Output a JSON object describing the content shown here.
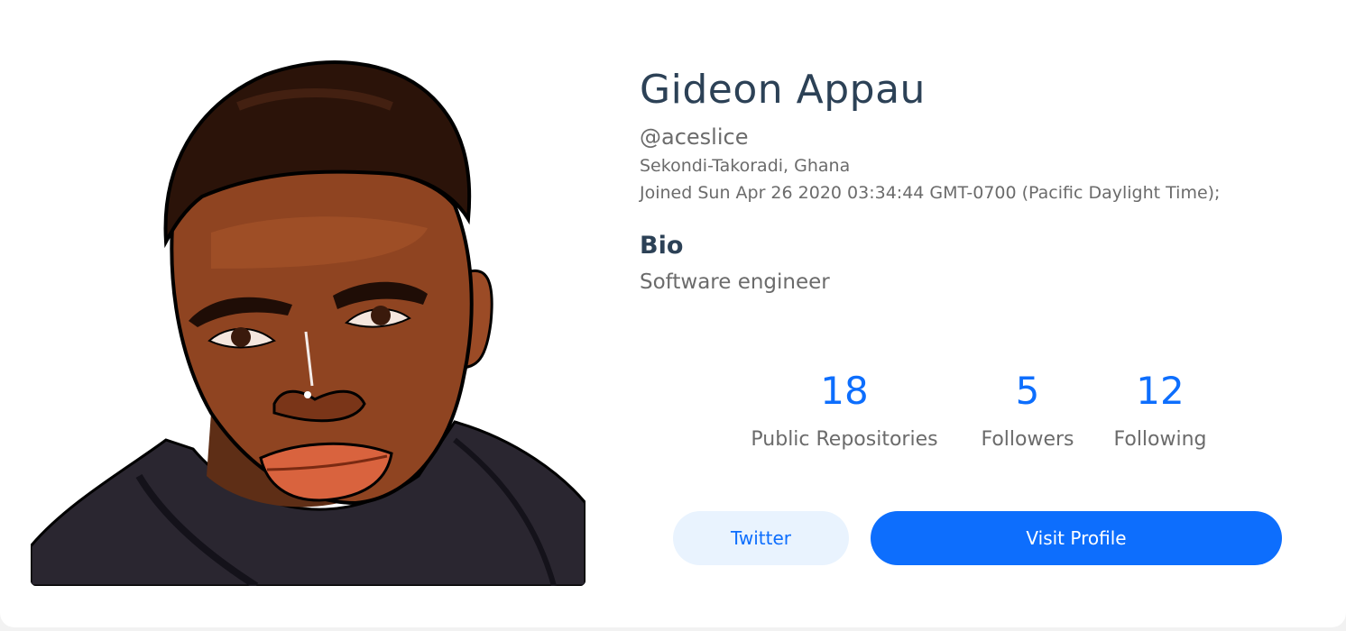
{
  "profile": {
    "name": "Gideon Appau",
    "login": "@aceslice",
    "location": "Sekondi-Takoradi, Ghana",
    "joined": "Joined Sun Apr 26 2020 03:34:44 GMT-0700 (Pacific Daylight Time);",
    "bio_heading": "Bio",
    "bio": "Software engineer",
    "avatar_icon": "cartoon-portrait-avatar"
  },
  "stats": {
    "repos": {
      "value": "18",
      "label": "Public Repositories"
    },
    "followers": {
      "value": "5",
      "label": "Followers"
    },
    "following": {
      "value": "12",
      "label": "Following"
    }
  },
  "buttons": {
    "twitter": "Twitter",
    "visit_profile": "Visit Profile"
  },
  "colors": {
    "accent": "#0d6efd",
    "heading": "#2c4156",
    "muted": "#6b6b6b",
    "twitter_bg": "#e9f3fe"
  }
}
